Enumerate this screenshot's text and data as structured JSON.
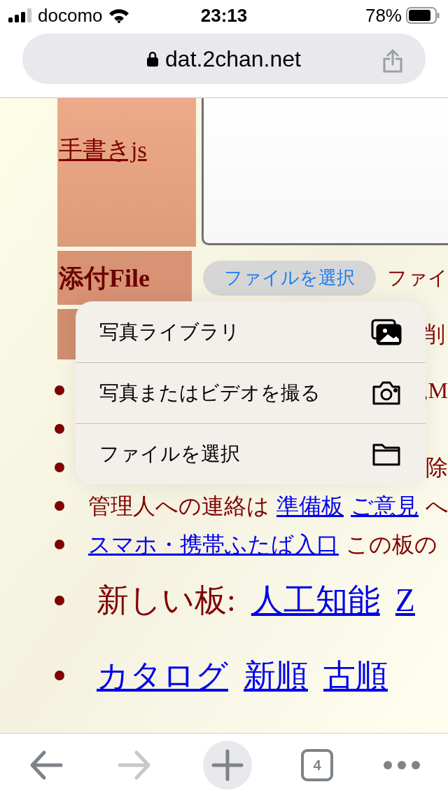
{
  "status_bar": {
    "carrier": "docomo",
    "time": "23:13",
    "battery": "78%"
  },
  "address_bar": {
    "url": "dat.2chan.net"
  },
  "form": {
    "rows": [
      {
        "kind": "comment",
        "label": "手書きjs"
      },
      {
        "kind": "file",
        "label": "添付File",
        "button": "ファイルを選択",
        "status": "ファイ"
      },
      {
        "kind": "delete",
        "trailing": "削"
      }
    ]
  },
  "notes": [
    {
      "kind": "covered",
      "parts": [
        {
          "text": ",M",
          "link": false
        }
      ]
    },
    {
      "kind": "covered"
    },
    {
      "kind": "covered",
      "parts": [
        {
          "text": "除",
          "link": false
        }
      ]
    },
    {
      "kind": "normal",
      "parts": [
        {
          "text": "管理人への連絡は",
          "link": false
        },
        {
          "text": "準備板",
          "link": true
        },
        {
          "text": "ご意見",
          "link": true
        },
        {
          "text": "へ",
          "link": false
        }
      ]
    },
    {
      "kind": "normal",
      "parts": [
        {
          "text": "スマホ・携帯ふたば入口",
          "link": true
        },
        {
          "text": "この板の",
          "link": false
        }
      ]
    },
    {
      "kind": "large",
      "parts": [
        {
          "text": "新しい板:",
          "link": false
        },
        {
          "text": "人工知能",
          "link": true
        },
        {
          "text": "Z",
          "link": true
        }
      ]
    },
    {
      "kind": "large",
      "parts": [
        {
          "text": "カタログ",
          "link": true
        },
        {
          "text": "新順",
          "link": true
        },
        {
          "text": "古順",
          "link": true
        }
      ]
    }
  ],
  "file_menu": {
    "items": [
      {
        "kind": "photos",
        "label": "写真ライブラリ"
      },
      {
        "kind": "camera",
        "label": "写真またはビデオを撮る"
      },
      {
        "kind": "folder",
        "label": "ファイルを選択"
      }
    ]
  },
  "toolbar": {
    "buttons": [
      {
        "kind": "back",
        "disabled": false
      },
      {
        "kind": "forward",
        "disabled": true
      },
      {
        "kind": "new_tab",
        "disabled": false
      },
      {
        "kind": "tabs",
        "count": "4",
        "disabled": false
      },
      {
        "kind": "more",
        "disabled": false
      }
    ]
  }
}
